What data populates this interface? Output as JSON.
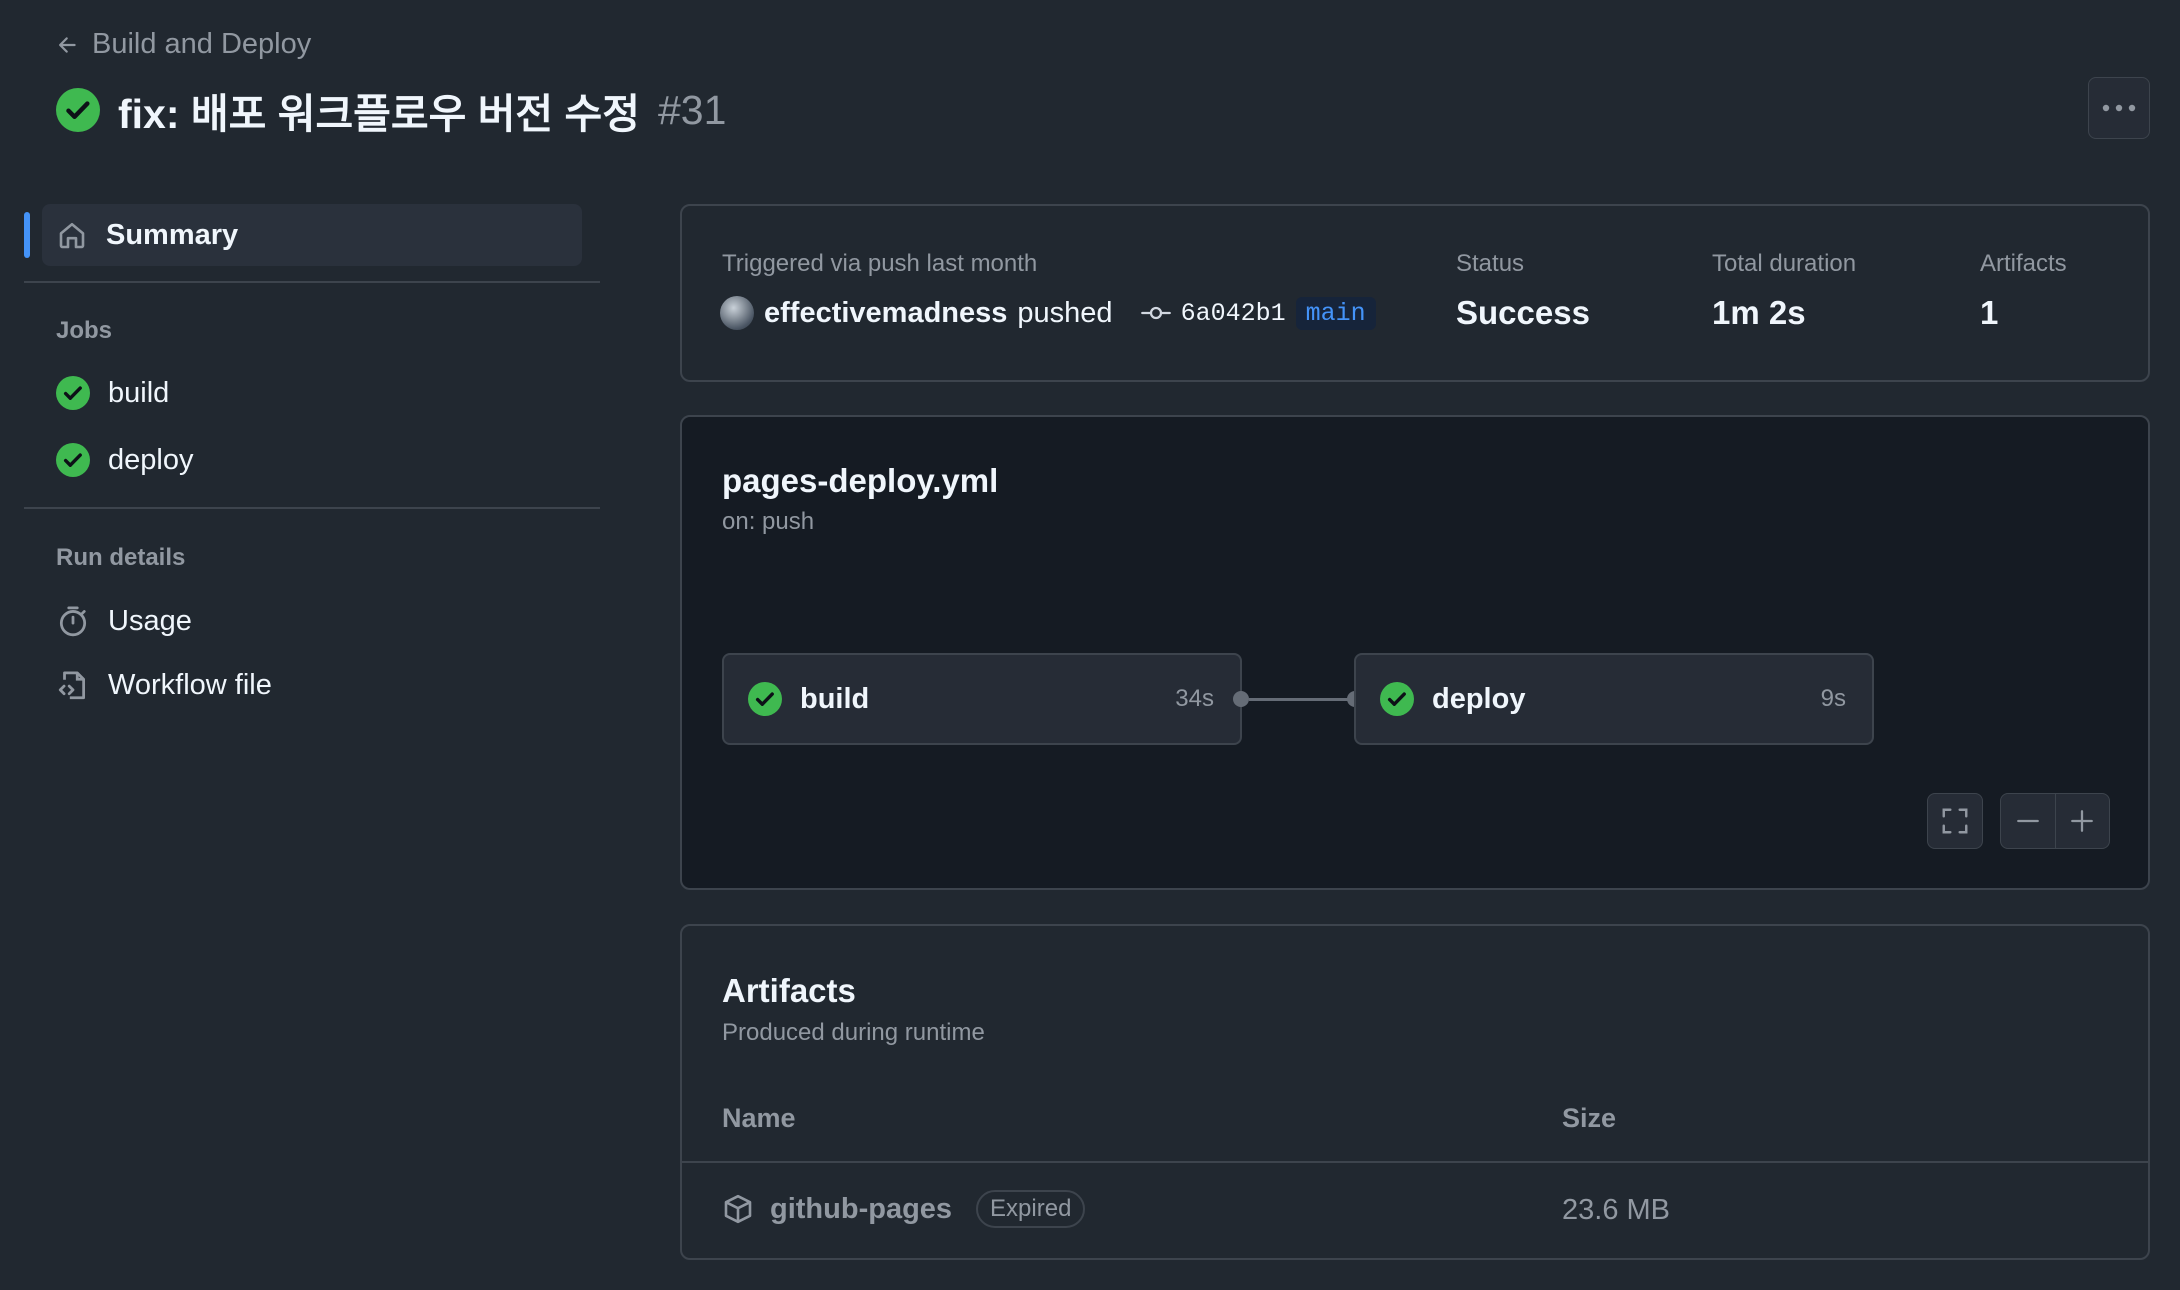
{
  "header": {
    "back_label": "Build and Deploy",
    "run_title": "fix: 배포 워크플로우 버전 수정",
    "run_number": "#31"
  },
  "sidebar": {
    "summary_label": "Summary",
    "jobs_heading": "Jobs",
    "jobs": [
      {
        "label": "build",
        "status": "success"
      },
      {
        "label": "deploy",
        "status": "success"
      }
    ],
    "run_details_heading": "Run details",
    "usage_label": "Usage",
    "workflow_file_label": "Workflow file"
  },
  "summary": {
    "trigger_text": "Triggered via push last month",
    "actor": "effectivemadness",
    "action": "pushed",
    "commit_sha": "6a042b1",
    "branch": "main",
    "status_label": "Status",
    "status_value": "Success",
    "duration_label": "Total duration",
    "duration_value": "1m 2s",
    "artifacts_label": "Artifacts",
    "artifacts_value": "1"
  },
  "workflow": {
    "file_name": "pages-deploy.yml",
    "trigger": "on: push",
    "jobs": [
      {
        "name": "build",
        "duration": "34s",
        "status": "success"
      },
      {
        "name": "deploy",
        "duration": "9s",
        "status": "success"
      }
    ]
  },
  "artifacts": {
    "title": "Artifacts",
    "subtitle": "Produced during runtime",
    "col_name": "Name",
    "col_size": "Size",
    "rows": [
      {
        "name": "github-pages",
        "badge": "Expired",
        "size": "23.6 MB"
      }
    ]
  },
  "colors": {
    "background": "#212830",
    "panel_dark": "#151b23",
    "border": "#3d444d",
    "success": "#3fb950",
    "accent": "#4493f8"
  },
  "icons": [
    "arrow-left-icon",
    "check-circle-icon",
    "kebab-horizontal-icon",
    "home-icon",
    "stopwatch-icon",
    "file-code-icon",
    "git-commit-icon",
    "fullscreen-icon",
    "zoom-out-icon",
    "zoom-in-icon",
    "package-icon"
  ]
}
